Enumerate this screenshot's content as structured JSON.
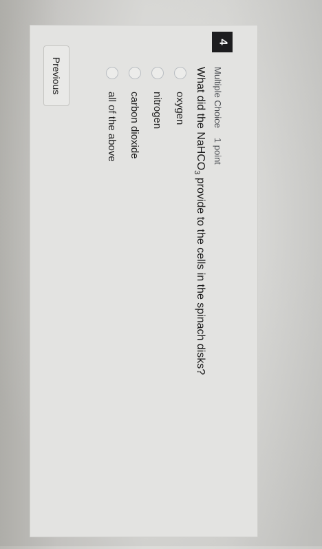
{
  "question": {
    "number": "4",
    "type": "Multiple Choice",
    "points": "1 point",
    "prompt_prefix": "What did the NaHCO",
    "prompt_subscript": "3",
    "prompt_suffix": " provide to the cells in the spinach disks?",
    "options": [
      "oxygen",
      "nitrogen",
      "carbon dioxide",
      "all of the above"
    ]
  },
  "nav": {
    "previous_label": "Previous"
  }
}
